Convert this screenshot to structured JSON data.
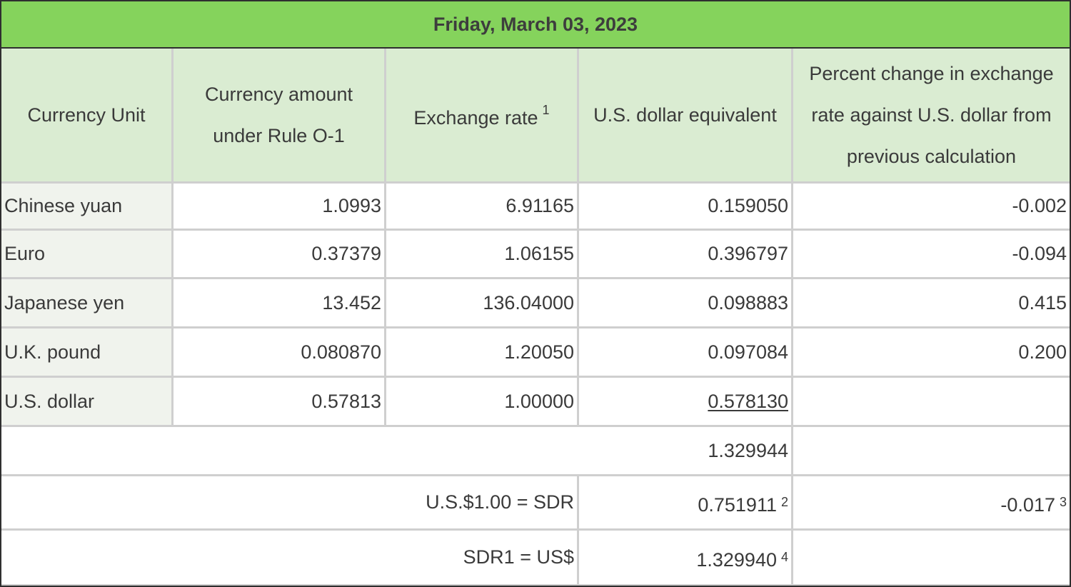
{
  "title": "Friday, March 03, 2023",
  "headers": {
    "currency_unit": "Currency Unit",
    "currency_amount_line1": "Currency amount",
    "currency_amount_line2": "under Rule O-1",
    "exchange_rate": "Exchange rate",
    "exchange_rate_note": "1",
    "usd_equivalent": "U.S. dollar equivalent",
    "pct_change_line1": "Percent change in exchange",
    "pct_change_line2": "rate against U.S. dollar from",
    "pct_change_line3": "previous calculation"
  },
  "rows": [
    {
      "currency": "Chinese yuan",
      "amount": "1.0993",
      "rate": "6.91165",
      "usd": "0.159050",
      "pct": "-0.002"
    },
    {
      "currency": "Euro",
      "amount": "0.37379",
      "rate": "1.06155",
      "usd": "0.396797",
      "pct": "-0.094"
    },
    {
      "currency": "Japanese yen",
      "amount": "13.452",
      "rate": "136.04000",
      "usd": "0.098883",
      "pct": "0.415"
    },
    {
      "currency": "U.K. pound",
      "amount": "0.080870",
      "rate": "1.20050",
      "usd": "0.097084",
      "pct": "0.200"
    },
    {
      "currency": "U.S. dollar",
      "amount": "0.57813",
      "rate": "1.00000",
      "usd": "0.578130",
      "pct": ""
    }
  ],
  "total": "1.329944",
  "sdr_per_usd": {
    "label": "U.S.$1.00 = SDR",
    "value": "0.751911",
    "value_note": "2",
    "pct": "-0.017",
    "pct_note": "3"
  },
  "usd_per_sdr": {
    "label": "SDR1 = US$",
    "value": "1.329940",
    "value_note": "4"
  }
}
